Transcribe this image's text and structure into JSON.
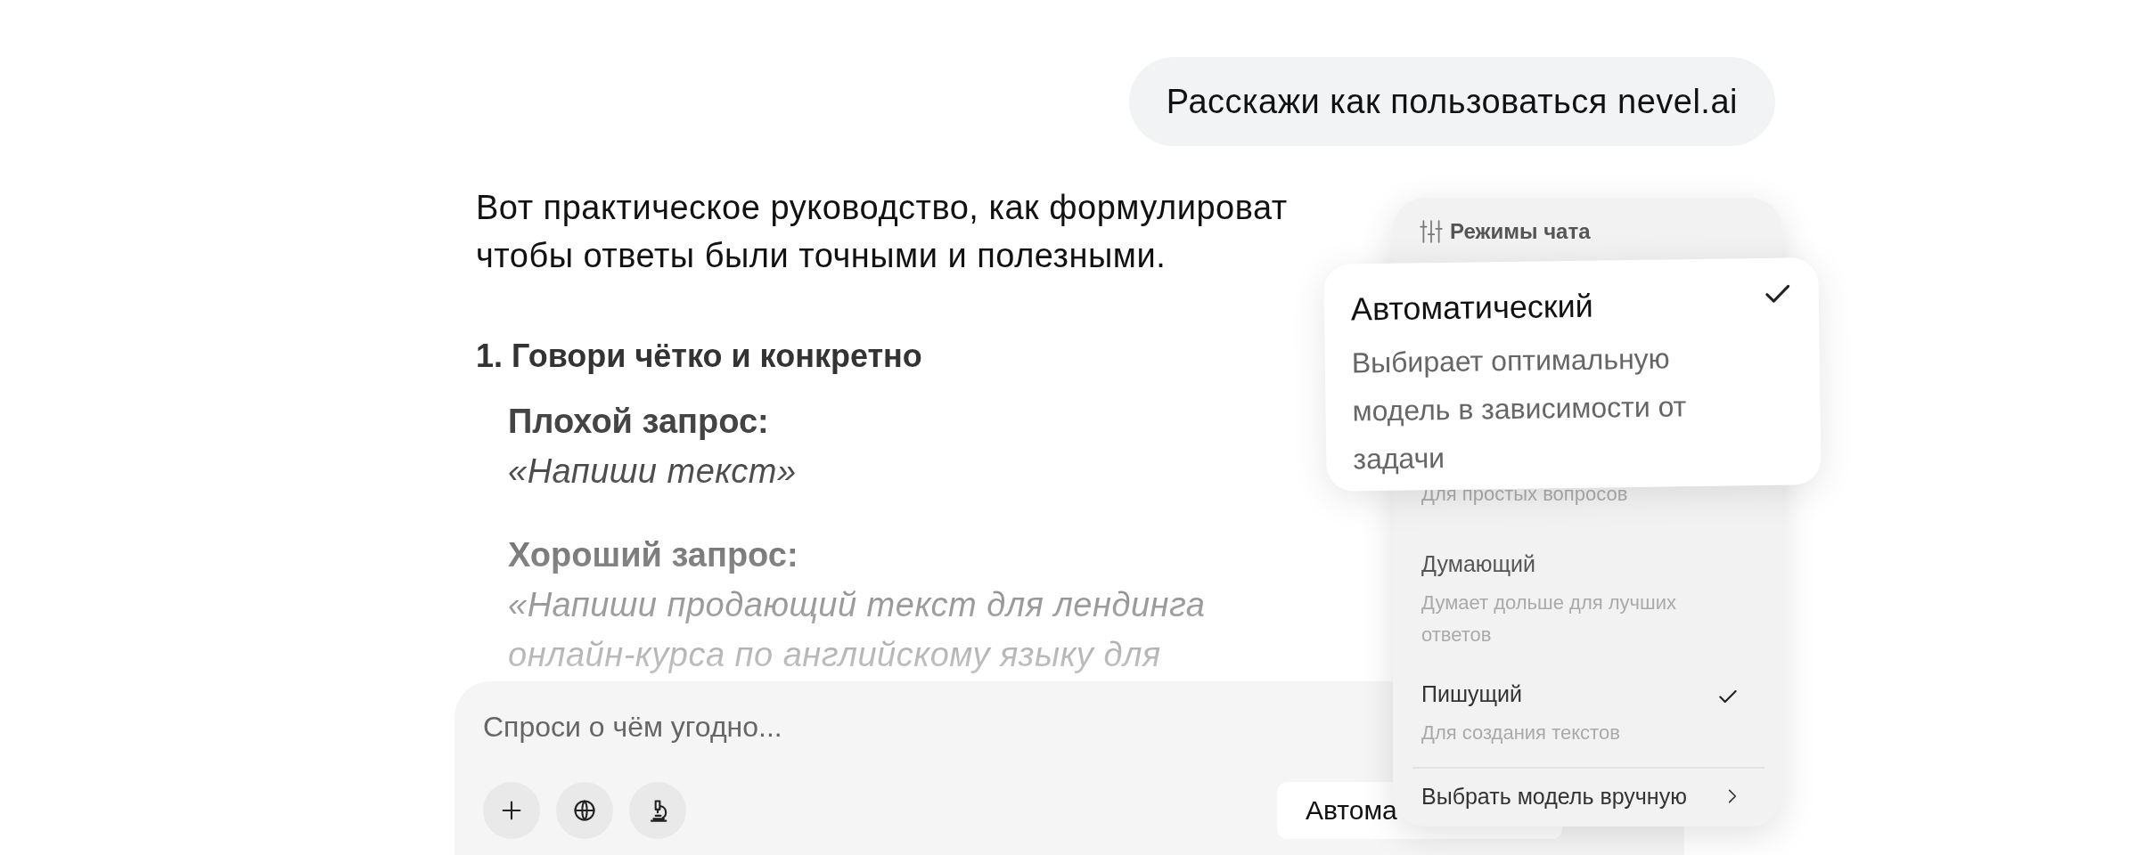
{
  "user_message": {
    "text": "Расскажи как пользоваться nevel.ai"
  },
  "response": {
    "intro_lines": [
      "Вот практическое руководство, как формулироват",
      "чтобы ответы были точными и полезными."
    ],
    "sections": [
      {
        "heading": "1. Говори чётко и конкретно",
        "examples": [
          {
            "label": "Плохой запрос:",
            "lines": [
              "«Напиши текст»"
            ]
          },
          {
            "label": "Хороший запрос:",
            "lines": [
              "«Напиши продающий текст для лендинга",
              "онлайн-курса по английскому языку для"
            ]
          }
        ]
      }
    ]
  },
  "composer": {
    "placeholder": "Спроси о чём угодно...",
    "tools": [
      {
        "kind": "add"
      },
      {
        "kind": "web"
      },
      {
        "kind": "research"
      }
    ],
    "mode_button": {
      "label": "Автома"
    }
  },
  "mode_menu": {
    "title": "Режимы чата",
    "highlighted": {
      "title": "Автоматический",
      "description": "Выбирает оптимальную модель в зависимости от задачи",
      "checked": true
    },
    "items": [
      {
        "description": "Для простых вопросов"
      },
      {
        "title": "Думающий",
        "description": "Думает дольше для лучших ответов",
        "checked": false
      },
      {
        "title": "Пишущий",
        "description": "Для создания текстов",
        "checked": true
      }
    ],
    "footer": {
      "label": "Выбрать модель вручную"
    }
  }
}
